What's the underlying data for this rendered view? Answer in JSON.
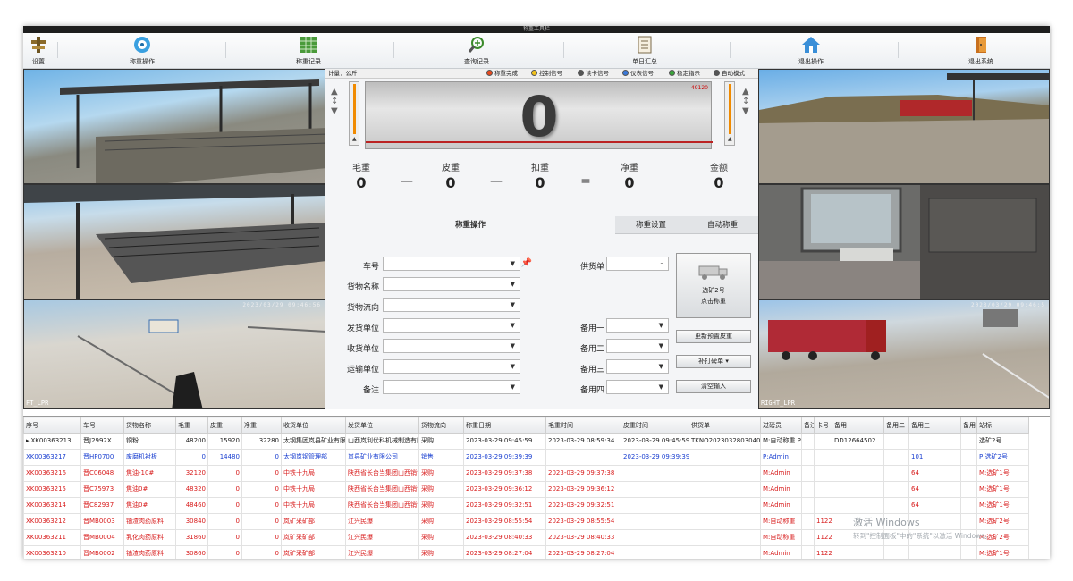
{
  "window": {
    "title": "称重工具栏"
  },
  "toolbar": {
    "items": [
      {
        "label": "设置",
        "icon": "settings-icon"
      },
      {
        "label": "称重操作",
        "icon": "weighing-icon"
      },
      {
        "label": "称重记录",
        "icon": "records-icon"
      },
      {
        "label": "查询记录",
        "icon": "search-icon"
      },
      {
        "label": "单日汇总",
        "icon": "summary-icon"
      },
      {
        "label": "退出操作",
        "icon": "home-icon"
      },
      {
        "label": "退出系统",
        "icon": "exit-icon"
      }
    ]
  },
  "cameras": {
    "left": [
      {
        "label": "",
        "timestamp": ""
      },
      {
        "label": "",
        "timestamp": ""
      },
      {
        "label": "FT_LPR",
        "timestamp": "2023/03/29 09:46:56"
      }
    ],
    "right": [
      {
        "label": "",
        "timestamp": ""
      },
      {
        "label": "",
        "timestamp": ""
      },
      {
        "label": "RIGHT_LPR",
        "timestamp": "2023/03/29 09:46:5"
      }
    ]
  },
  "signals": {
    "unit": "计量：公斤",
    "items": [
      {
        "label": "称重完成",
        "color": "#e8491d"
      },
      {
        "label": "控制信号",
        "color": "#f2c21a"
      },
      {
        "label": "读卡信号",
        "color": "#555555"
      },
      {
        "label": "仪表信号",
        "color": "#3a78d8"
      },
      {
        "label": "稳定指示",
        "color": "#3aa53a"
      },
      {
        "label": "自动模式",
        "color": "#555555"
      }
    ]
  },
  "scale": {
    "value": "0",
    "max": "49120"
  },
  "weights": {
    "gross": {
      "label": "毛重",
      "value": "0"
    },
    "tare": {
      "label": "皮重",
      "value": "0"
    },
    "deduct": {
      "label": "扣重",
      "value": "0"
    },
    "net": {
      "label": "净重",
      "value": "0"
    },
    "amount": {
      "label": "金额",
      "value": "0"
    },
    "op_minus": "—",
    "op_equal": "="
  },
  "tabs": [
    {
      "label": "称重操作"
    },
    {
      "label": "称重设置"
    },
    {
      "label": "自动称重"
    }
  ],
  "form": {
    "plate": {
      "label": "车号",
      "value": ""
    },
    "goods": {
      "label": "货物名称",
      "value": ""
    },
    "flow": {
      "label": "货物流向",
      "value": ""
    },
    "sender": {
      "label": "发货单位",
      "value": ""
    },
    "receiver": {
      "label": "收货单位",
      "value": ""
    },
    "transport": {
      "label": "运输单位",
      "value": ""
    },
    "remark": {
      "label": "备注",
      "value": ""
    },
    "supplier_doc": {
      "label": "供货单",
      "value": ""
    },
    "spare1": {
      "label": "备用一",
      "value": ""
    },
    "spare2": {
      "label": "备用二",
      "value": ""
    },
    "spare3": {
      "label": "备用三",
      "value": ""
    },
    "spare4": {
      "label": "备用四",
      "value": ""
    }
  },
  "buttons": {
    "weigh_line1": "选矿2号",
    "weigh_line2": "点击称重",
    "update_tare": "更新预置皮重",
    "reprint": "补打磅单",
    "clear": "清空输入"
  },
  "grid": {
    "columns": [
      "序号",
      "车号",
      "货物名称",
      "毛重",
      "皮重",
      "净重",
      "收货单位",
      "发货单位",
      "货物流向",
      "称重日期",
      "毛重时间",
      "皮重时间",
      "供货单",
      "过磅员",
      "备注",
      "卡号",
      "备用一",
      "备用二",
      "备用三",
      "备用四",
      "站标"
    ],
    "rows": [
      {
        "style": "blk",
        "marker": "▸",
        "cells": [
          "XK00363213",
          "晋J2992X",
          "铜粉",
          "48200",
          "15920",
          "32280",
          "太钢集团岚县矿业有限公司总厂",
          "山西岚利优科机械制造有限公司",
          "采购",
          "2023-03-29 09:45:59",
          "2023-03-29 08:59:34",
          "2023-03-29 09:45:59",
          "TKNO2023032803040",
          "M:自动称重 P:Admin",
          "",
          "",
          "DD12664502",
          "",
          "",
          "",
          "选矿2号"
        ]
      },
      {
        "style": "blu",
        "marker": "",
        "cells": [
          "XK00363217",
          "晋HP0700",
          "废磨机衬板",
          "0",
          "14480",
          "0",
          "太钢岚钢管理部",
          "岚县矿业有限公司",
          "销售",
          "2023-03-29 09:39:39",
          "",
          "2023-03-29 09:39:39",
          "",
          "P:Admin",
          "",
          "",
          "",
          "",
          "101",
          "",
          "P:选矿2号"
        ]
      },
      {
        "style": "red",
        "marker": "",
        "cells": [
          "XK00363216",
          "晋C06048",
          "焦油-10#",
          "32120",
          "0",
          "0",
          "中铁十九局",
          "陕西省长台当集团山西销售有限公司",
          "采购",
          "2023-03-29 09:37:38",
          "2023-03-29 09:37:38",
          "",
          "",
          "M:Admin",
          "",
          "",
          "",
          "",
          "64",
          "",
          "M:选矿1号"
        ]
      },
      {
        "style": "red",
        "marker": "",
        "cells": [
          "XK00363215",
          "晋C75973",
          "焦油0#",
          "48320",
          "0",
          "0",
          "中铁十九局",
          "陕西省长台当集团山西销售有限公司",
          "采购",
          "2023-03-29 09:36:12",
          "2023-03-29 09:36:12",
          "",
          "",
          "M:Admin",
          "",
          "",
          "",
          "",
          "64",
          "",
          "M:选矿1号"
        ]
      },
      {
        "style": "red",
        "marker": "",
        "cells": [
          "XK00363214",
          "晋C82937",
          "焦油0#",
          "48460",
          "0",
          "0",
          "中铁十九局",
          "陕西省长台当集团山西销售有限公司",
          "采购",
          "2023-03-29 09:32:51",
          "2023-03-29 09:32:51",
          "",
          "",
          "M:Admin",
          "",
          "",
          "",
          "",
          "64",
          "",
          "M:选矿1号"
        ]
      },
      {
        "style": "red",
        "marker": "",
        "cells": [
          "XK00363212",
          "晋MB0003",
          "铀渣肉药原料",
          "30840",
          "0",
          "0",
          "岚矿采矿部",
          "江兴民爆",
          "采购",
          "2023-03-29 08:55:54",
          "2023-03-29 08:55:54",
          "",
          "",
          "M:自动称重",
          "",
          "1122",
          "",
          "",
          "",
          "",
          "M:选矿2号"
        ]
      },
      {
        "style": "red",
        "marker": "",
        "cells": [
          "XK00363211",
          "晋MB0004",
          "乳化肉药原料",
          "31860",
          "0",
          "0",
          "岚矿采矿部",
          "江兴民爆",
          "采购",
          "2023-03-29 08:40:33",
          "2023-03-29 08:40:33",
          "",
          "",
          "M:自动称重",
          "",
          "1122",
          "",
          "",
          "",
          "",
          "M:选矿2号"
        ]
      },
      {
        "style": "red",
        "marker": "",
        "cells": [
          "XK00363210",
          "晋MB0002",
          "铀渣肉药原料",
          "30860",
          "0",
          "0",
          "岚矿采矿部",
          "江兴民爆",
          "采购",
          "2023-03-29 08:27:04",
          "2023-03-29 08:27:04",
          "",
          "",
          "M:Admin",
          "",
          "1122",
          "",
          "",
          "",
          "",
          "M:选矿1号"
        ]
      }
    ]
  },
  "watermark": {
    "title": "激活 Windows",
    "subtitle": "转到\"控制面板\"中的\"系统\"以激活 Windows。"
  }
}
